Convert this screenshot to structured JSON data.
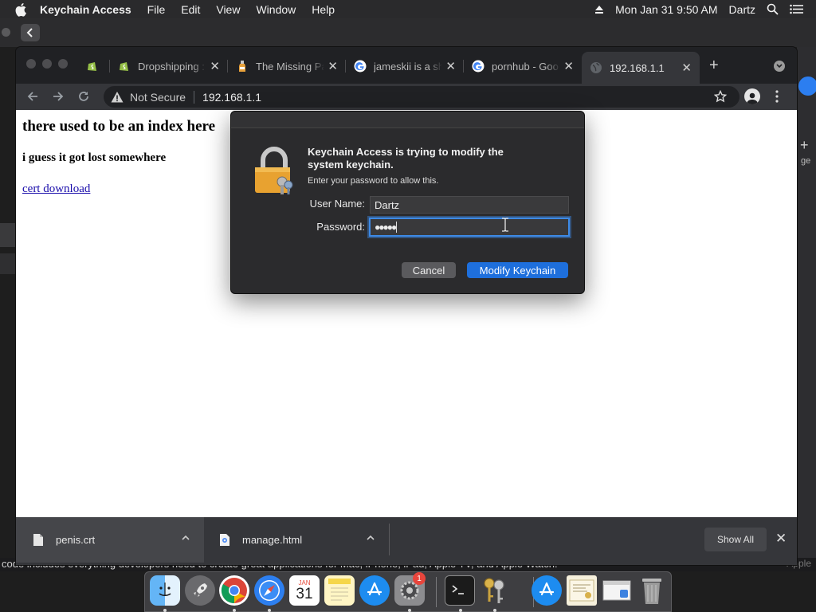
{
  "menubar": {
    "apple_icon": "apple-logo",
    "app_name": "Keychain Access",
    "items": [
      "File",
      "Edit",
      "View",
      "Window",
      "Help"
    ],
    "clock": "Mon Jan 31  9:50 AM",
    "user": "Dartz"
  },
  "background": {
    "plus": "+",
    "ge": "ge",
    "bottom_text": "code includes everything developers need to create great applications for Mac, iPhone, iPad, Apple TV, and Apple Watch.",
    "apple_text": "Apple"
  },
  "browser": {
    "tabs": [
      {
        "title": "",
        "favicon": "shopify-icon"
      },
      {
        "title": "Dropshipping :",
        "favicon": "shopify-icon"
      },
      {
        "title": "The Missing Pa",
        "favicon": "bottle-icon"
      },
      {
        "title": "jameskii is a sh",
        "favicon": "google-icon"
      },
      {
        "title": "pornhub - Goo",
        "favicon": "google-icon"
      },
      {
        "title": "192.168.1.1",
        "favicon": "globe-icon",
        "active": true
      }
    ],
    "omnibox": {
      "security_label": "Not Secure",
      "url": "192.168.1.1"
    }
  },
  "webpage": {
    "heading": "there used to be an index here",
    "subheading": "i guess it got lost somewhere",
    "link": "cert download"
  },
  "downloads": {
    "items": [
      {
        "name": "penis.crt"
      },
      {
        "name": "manage.html"
      }
    ],
    "show_all": "Show All"
  },
  "dialog": {
    "heading": "Keychain Access is trying to modify the system keychain.",
    "subtext": "Enter your password to allow this.",
    "username_label": "User Name:",
    "username_value": "Dartz",
    "password_label": "Password:",
    "password_value": "●●●●●",
    "cancel_label": "Cancel",
    "confirm_label": "Modify Keychain"
  },
  "dock": {
    "apps": [
      "Finder",
      "Launchpad",
      "Google Chrome",
      "Safari",
      "Calendar",
      "Notes",
      "App Store",
      "System Preferences",
      "Terminal",
      "Keychain Access",
      "App Store",
      "Certificate",
      "Preview",
      "Trash"
    ],
    "calendar_month": "JAN",
    "calendar_day": "31",
    "badge_count": "1"
  }
}
